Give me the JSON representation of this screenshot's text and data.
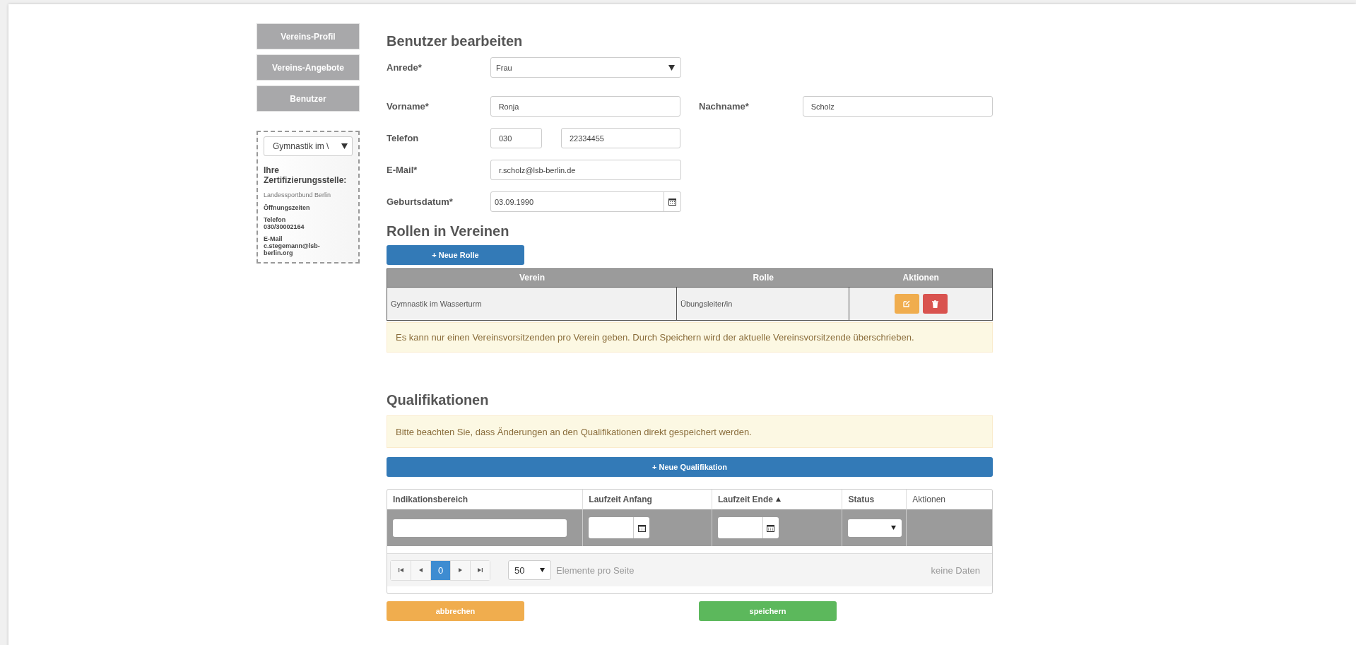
{
  "nav": [
    {
      "label": "Vereins-Profil"
    },
    {
      "label": "Vereins-Angebote"
    },
    {
      "label": "Benutzer"
    }
  ],
  "club_select": {
    "value": "Gymnastik im \\"
  },
  "certification": {
    "heading": "Ihre Zertifizierungsstelle:",
    "name": "Landessportbund Berlin",
    "hours_label": "Öffnungszeiten",
    "phone_label": "Telefon",
    "phone": "030/30002164",
    "email_label": "E-Mail",
    "email": "c.stegemann@lsb-berlin.org"
  },
  "form": {
    "title": "Benutzer bearbeiten",
    "salutation": {
      "label": "Anrede*",
      "value": "Frau"
    },
    "first_name": {
      "label": "Vorname*",
      "value": "Ronja"
    },
    "last_name": {
      "label": "Nachname*",
      "value": "Scholz"
    },
    "phone": {
      "label": "Telefon",
      "area_code": "030",
      "number": "22334455"
    },
    "email": {
      "label": "E-Mail*",
      "value": "r.scholz@lsb-berlin.de"
    },
    "birthdate": {
      "label": "Geburtsdatum*",
      "value": "03.09.1990"
    }
  },
  "roles": {
    "title": "Rollen in Vereinen",
    "add_button": "+ Neue Rolle",
    "columns": [
      "Verein",
      "Rolle",
      "Aktionen"
    ],
    "rows": [
      {
        "club": "Gymnastik im Wasserturm",
        "role": "Übungsleiter/in"
      }
    ],
    "notice": "Es kann nur einen Vereinsvorsitzenden pro Verein geben. Durch Speichern wird der aktuelle Vereinsvorsitzende überschrieben."
  },
  "qualifications": {
    "title": "Qualifikationen",
    "notice": "Bitte beachten Sie, dass Änderungen an den Qualifikationen direkt gespeichert werden.",
    "add_button": "+ Neue Qualifikation",
    "columns": [
      {
        "label": "Indikationsbereich",
        "kind": "text",
        "sorted": false
      },
      {
        "label": "Laufzeit Anfang",
        "kind": "date",
        "sorted": false
      },
      {
        "label": "Laufzeit Ende",
        "kind": "date",
        "sorted": true
      },
      {
        "label": "Status",
        "kind": "select",
        "sorted": false
      },
      {
        "label": "Aktionen",
        "kind": "plain",
        "sorted": false
      }
    ],
    "pagination": {
      "page": "0",
      "page_size": "50",
      "page_size_label": "Elemente pro Seite",
      "empty_text": "keine Daten"
    }
  },
  "buttons": {
    "cancel": "abbrechen",
    "save": "speichern"
  }
}
